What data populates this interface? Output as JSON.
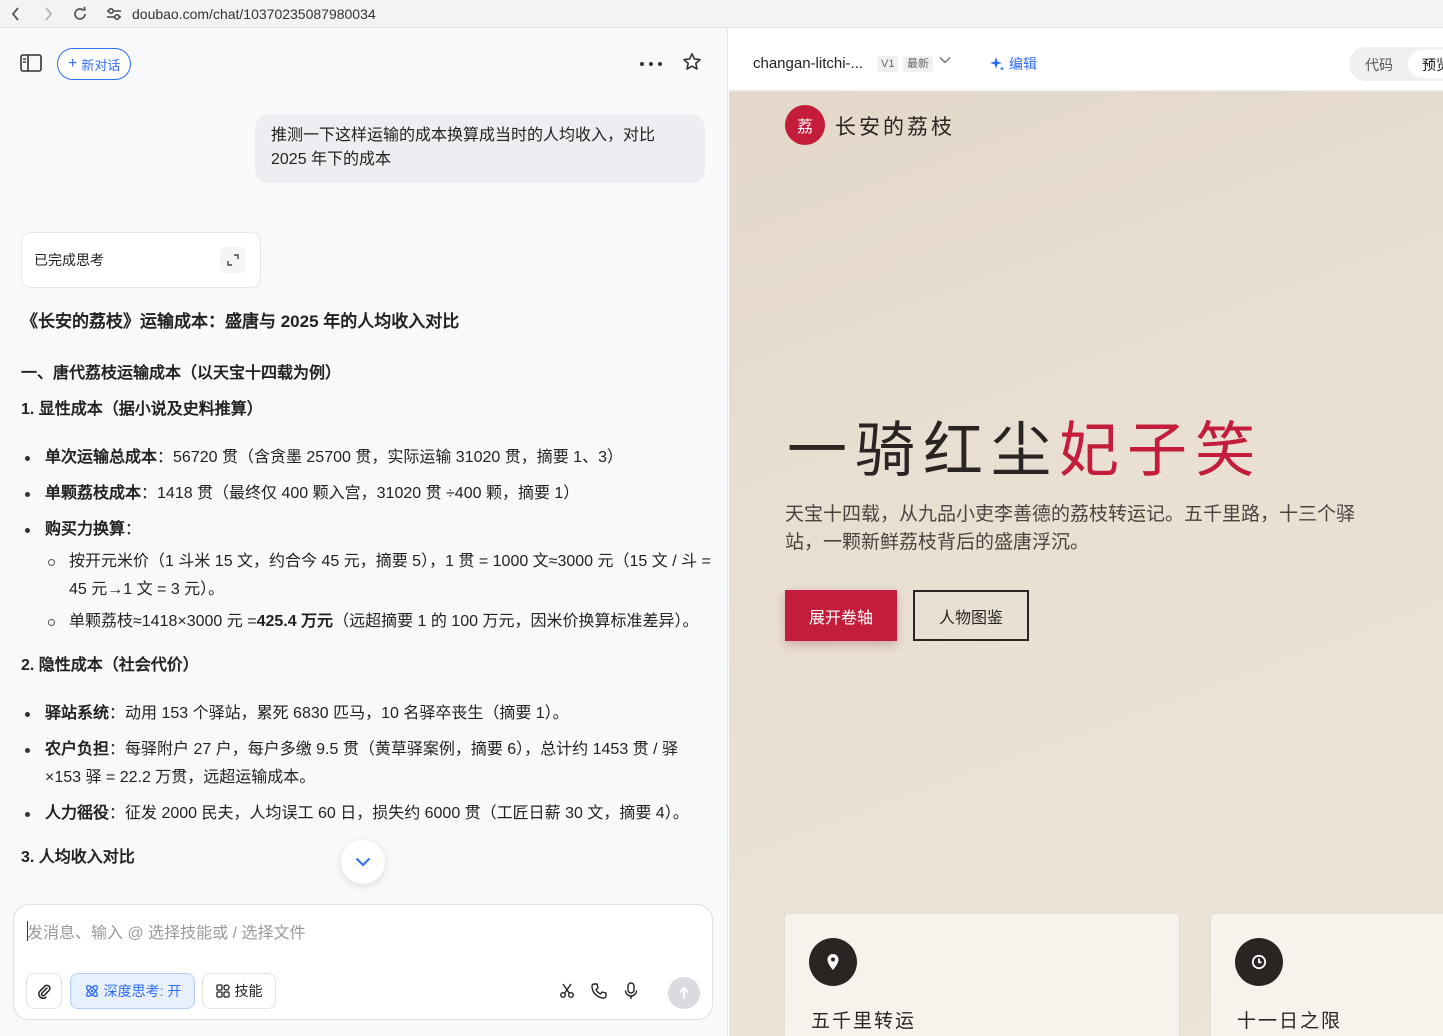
{
  "browser": {
    "url": "doubao.com/chat/10370235087980034"
  },
  "chat": {
    "new_chat_label": "新对话",
    "user_message": "推测一下这样运输的成本换算成当时的人均收入，对比 2025 年下的成本",
    "thinking_label": "已完成思考",
    "answer": {
      "title": "《长安的荔枝》运输成本：盛唐与 2025 年的人均收入对比",
      "section1": "一、唐代荔枝运输成本（以天宝十四载为例）",
      "sub1": "1. 显性成本（据小说及史料推算）",
      "items1": [
        {
          "key": "单次运输总成本",
          "text": "：56720 贯（含贪墨 25700 贯，实际运输 31020 贯，摘要 1、3）"
        },
        {
          "key": "单颗荔枝成本",
          "text": "：1418 贯（最终仅 400 颗入宫，31020 贯 ÷400 颗，摘要 1）"
        },
        {
          "key": "购买力换算",
          "text": "："
        }
      ],
      "sub_items1": [
        {
          "text": "按开元米价（1 斗米 15 文，约合今 45 元，摘要 5），1 贯 = 1000 文≈3000 元（15 文 / 斗 = 45 元→1 文 = 3 元）。"
        },
        {
          "pre": "单颗荔枝≈1418×3000 元 =",
          "bold": "425.4 万元",
          "post": "（远超摘要 1 的 100 万元，因米价换算标准差异）。"
        }
      ],
      "sub2": "2. 隐性成本（社会代价）",
      "items2": [
        {
          "key": "驿站系统",
          "text": "：动用 153 个驿站，累死 6830 匹马，10 名驿卒丧生（摘要 1）。"
        },
        {
          "key": "农户负担",
          "text": "：每驿附户 27 户，每户多缴 9.5 贯（黄草驿案例，摘要 6），总计约 1453 贯 / 驿 ×153 驿 = 22.2 万贯，远超运输成本。"
        },
        {
          "key": "人力徭役",
          "text": "：征发 2000 民夫，人均误工 60 日，损失约 6000 贯（工匠日薪 30 文，摘要 4）。"
        }
      ],
      "sub3": "3. 人均收入对比"
    },
    "composer": {
      "placeholder": "发消息、输入 @ 选择技能或 / 选择文件",
      "deep_think_label": "深度思考: 开",
      "skills_label": "技能"
    }
  },
  "preview": {
    "file_name": "changan-litchi-...",
    "version": "V1",
    "latest_tag": "最新",
    "edit_label": "编辑",
    "tab_code": "代码",
    "tab_preview": "预览",
    "site": {
      "logo_char": "荔",
      "name": "长安的荔枝",
      "hero_title_dark": "一骑红尘",
      "hero_title_red": "妃子笑",
      "hero_subtitle": "天宝十四载，从九品小吏李善德的荔枝转运记。五千里路，十三个驿站，一颗新鲜荔枝背后的盛唐浮沉。",
      "primary_button": "展开卷轴",
      "secondary_button": "人物图鉴",
      "cards": [
        {
          "title": "五千里转运",
          "icon": "location-pin-icon"
        },
        {
          "title": "十一日之限",
          "icon": "clock-icon"
        }
      ]
    }
  },
  "colors": {
    "accent_blue": "#2f6df6",
    "brand_red": "#c31d3b",
    "ink": "#2a2522",
    "paper": "#e7ddd0"
  }
}
